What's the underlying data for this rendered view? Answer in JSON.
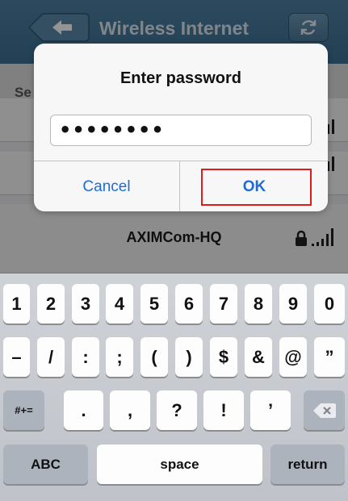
{
  "nav": {
    "title": "Wireless Internet",
    "back_icon": "arrow-left-icon",
    "refresh_icon": "refresh-icon"
  },
  "list": {
    "section_label": "Se",
    "networks": [
      {
        "name": ""
      },
      {
        "name": ""
      },
      {
        "name": "AXIMCom-HQ",
        "locked": true
      }
    ]
  },
  "dialog": {
    "title": "Enter password",
    "password_value": "••••••••",
    "cancel_label": "Cancel",
    "ok_label": "OK"
  },
  "keyboard": {
    "row1": [
      "1",
      "2",
      "3",
      "4",
      "5",
      "6",
      "7",
      "8",
      "9",
      "0"
    ],
    "row2": [
      "–",
      "/",
      ":",
      ";",
      "(",
      ")",
      "$",
      "&",
      "@",
      "”"
    ],
    "row3": [
      ".",
      ",",
      "?",
      "!",
      "’"
    ],
    "shift_label": "#+=",
    "backspace_icon": "backspace-icon",
    "abc_label": "ABC",
    "space_label": "space",
    "return_label": "return"
  },
  "colors": {
    "navbar": "#4677a0",
    "button_blue": "#1e6bd4",
    "highlight_red": "#e01b1b"
  }
}
